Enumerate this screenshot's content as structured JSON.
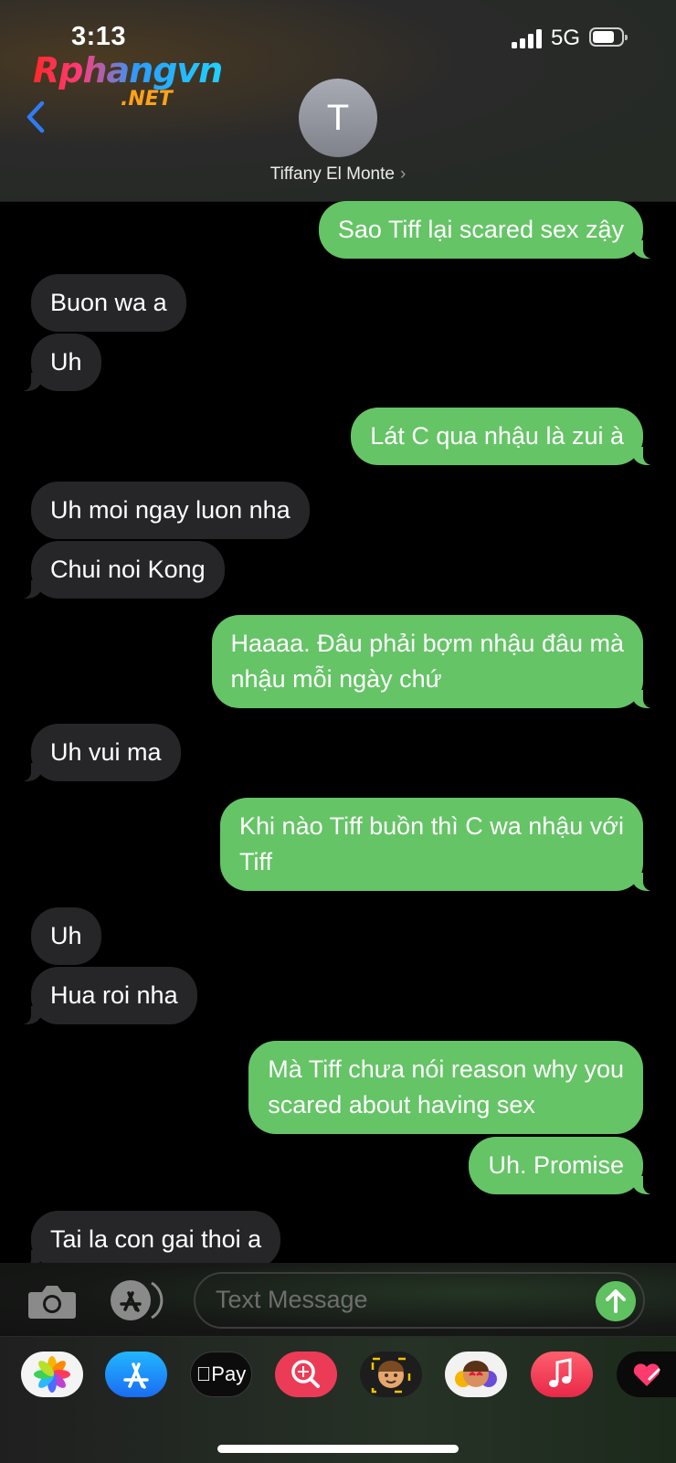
{
  "status_bar": {
    "time": "3:13",
    "network": "5G"
  },
  "watermark": {
    "line1": "Rphangvn",
    "line2": ".NET"
  },
  "contact": {
    "initial": "T",
    "name": "Tiffany El Monte",
    "chevron": "›"
  },
  "messages": [
    {
      "dir": "out",
      "text": "Sao Tiff lại scared sex zậy"
    },
    {
      "dir": "in",
      "text": "Buon wa a"
    },
    {
      "dir": "in",
      "text": "Uh"
    },
    {
      "dir": "out",
      "text": "Lát C qua nhậu là zui à"
    },
    {
      "dir": "in",
      "text": "Uh moi ngay luon nha"
    },
    {
      "dir": "in",
      "text": "Chui noi Kong"
    },
    {
      "dir": "out",
      "text": "Haaaa. Đâu phải bợm nhậu đâu mà\nnhậu mỗi ngày chứ"
    },
    {
      "dir": "in",
      "text": "Uh vui ma"
    },
    {
      "dir": "out",
      "text": "Khi nào Tiff buồn thì C wa nhậu với\nTiff"
    },
    {
      "dir": "in",
      "text": "Uh"
    },
    {
      "dir": "in",
      "text": "Hua roi nha"
    },
    {
      "dir": "out",
      "text": "Mà Tiff chưa nói reason why you\nscared about having sex"
    },
    {
      "dir": "out",
      "text": "Uh. Promise"
    },
    {
      "dir": "in",
      "text": "Tai la con gai thoi a"
    }
  ],
  "input": {
    "placeholder": "Text Message"
  },
  "app_drawer": {
    "items": [
      {
        "name": "photos-app-icon"
      },
      {
        "name": "app-store-icon"
      },
      {
        "name": "apple-pay-icon",
        "label": "Pay"
      },
      {
        "name": "image-search-icon"
      },
      {
        "name": "memoji-icon"
      },
      {
        "name": "animoji-stickers-icon"
      },
      {
        "name": "music-icon"
      },
      {
        "name": "digital-touch-icon"
      }
    ]
  },
  "colors": {
    "outgoing": "#65c466",
    "incoming": "#262628",
    "accent": "#2f7cf6"
  }
}
